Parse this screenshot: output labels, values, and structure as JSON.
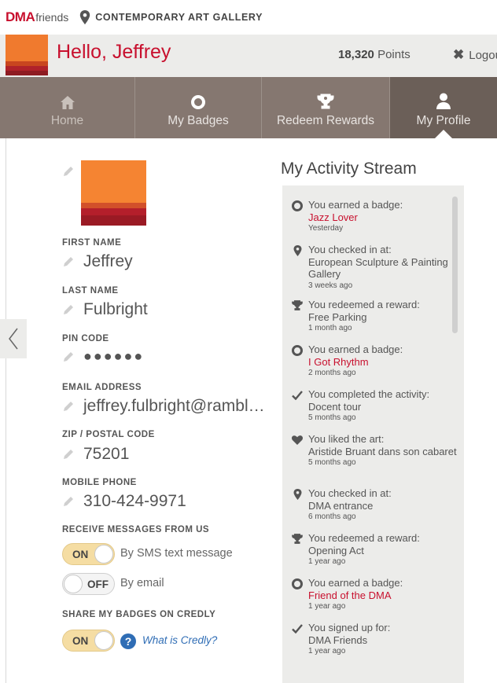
{
  "brand": {
    "logo_main": "DMA",
    "logo_sub": "friends",
    "location": "CONTEMPORARY ART GALLERY"
  },
  "header": {
    "greeting": "Hello, Jeffrey",
    "points_value": "18,320",
    "points_label": "Points",
    "logout_label": "Logout"
  },
  "nav": {
    "home": "Home",
    "badges": "My Badges",
    "redeem": "Redeem Rewards",
    "profile": "My Profile"
  },
  "profile": {
    "first_name_label": "FIRST NAME",
    "first_name": "Jeffrey",
    "last_name_label": "LAST NAME",
    "last_name": "Fulbright",
    "pin_label": "PIN CODE",
    "pin_value": "●●●●●●",
    "email_label": "EMAIL ADDRESS",
    "email": "jeffrey.fulbright@rambl…",
    "zip_label": "ZIP / POSTAL CODE",
    "zip": "75201",
    "phone_label": "MOBILE PHONE",
    "phone": "310-424-9971",
    "messages_label": "RECEIVE MESSAGES FROM US",
    "sms_toggle": "ON",
    "sms_desc": "By SMS text message",
    "email_toggle": "OFF",
    "email_desc": "By email",
    "share_label": "SHARE MY BADGES ON CREDLY",
    "share_toggle": "ON",
    "credly_link": "What is Credly?"
  },
  "stream": {
    "title": "My Activity Stream",
    "entries": [
      {
        "icon": "badge-icon",
        "text": "You earned a badge:",
        "name": "Jazz Lover",
        "name_red": true,
        "time": "Yesterday"
      },
      {
        "icon": "location-icon",
        "text": "You checked in at:",
        "name": "European Sculpture & Painting Gallery",
        "name_red": false,
        "time": "3 weeks ago"
      },
      {
        "icon": "trophy-icon",
        "text": "You redeemed a reward:",
        "name": "Free Parking",
        "name_red": false,
        "time": "1 month ago"
      },
      {
        "icon": "badge-icon",
        "text": "You earned a badge:",
        "name": "I Got Rhythm",
        "name_red": true,
        "time": "2 months ago"
      },
      {
        "icon": "check-icon",
        "text": "You completed the activity:",
        "name": "Docent tour",
        "name_red": false,
        "time": "5 months ago"
      },
      {
        "icon": "heart-icon",
        "text": "You liked the art:",
        "name": "Aristide Bruant dans son cabaret",
        "name_red": false,
        "time": "5 months ago"
      },
      {
        "icon": "location-icon",
        "text": "You checked in at:",
        "name": "DMA entrance",
        "name_red": false,
        "time": "6 months ago"
      },
      {
        "icon": "trophy-icon",
        "text": "You redeemed a reward:",
        "name": "Opening Act",
        "name_red": false,
        "time": "1 year ago"
      },
      {
        "icon": "badge-icon",
        "text": "You earned a badge:",
        "name": "Friend of the DMA",
        "name_red": true,
        "time": "1 year ago"
      },
      {
        "icon": "check-icon",
        "text": "You signed up for:",
        "name": "DMA Friends",
        "name_red": false,
        "time": "1 year ago"
      }
    ]
  },
  "colors": {
    "brand_red": "#c8102e",
    "nav_bg": "#857770",
    "nav_active": "#6b5f58",
    "toggle_on": "#f5dda3",
    "link_blue": "#2f6db5"
  }
}
